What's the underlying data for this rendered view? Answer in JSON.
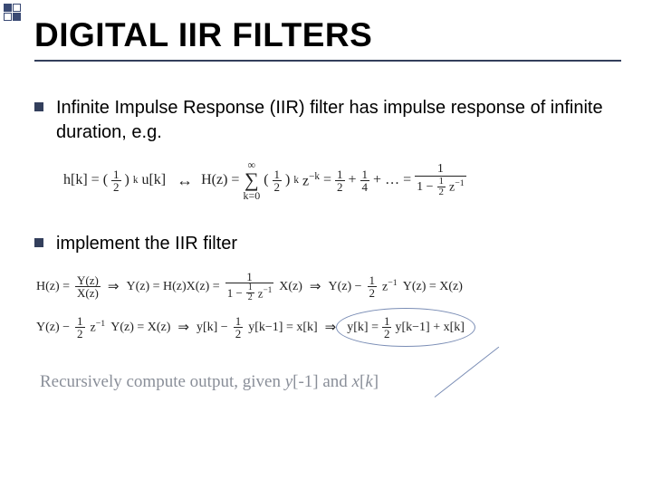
{
  "title": "DIGITAL IIR FILTERS",
  "bullets": [
    "Infinite Impulse Response (IIR) filter has impulse response of infinite duration, e.g.",
    "implement the IIR filter"
  ],
  "eq1": {
    "lhs_h": "h[k] =",
    "lhs_half_num": "1",
    "lhs_half_den": "2",
    "lhs_exp": "k",
    "lhs_u": "u[k]",
    "arrow": "↔",
    "Hz": "H(z) =",
    "sum_top": "∞",
    "sum_bot": "k=0",
    "sum_half_num": "1",
    "sum_half_den": "2",
    "sum_exp": "k",
    "z": "z",
    "z_exp": "−k",
    "eq_tail_start": "=",
    "tail_half1_num": "1",
    "tail_half1_den": "2",
    "tail_plus1": "+",
    "tail_half2_num": "1",
    "tail_half2_den": "4",
    "tail_plus2": "+ … =",
    "final_num": "1",
    "final_den_pre": "1 −",
    "final_den_half_num": "1",
    "final_den_half_den": "2",
    "final_den_z": "z",
    "final_den_zexp": "−1"
  },
  "eq2": {
    "line1": {
      "Hz": "H(z) =",
      "Yz": "Y(z)",
      "Xz": "X(z)",
      "impl": "⇒",
      "YzHX": "Y(z) = H(z)X(z) =",
      "one": "1",
      "den_pre": "1 −",
      "half_num": "1",
      "half_den": "2",
      "z": "z",
      "zexp": "−1",
      "Xz2": "X(z)",
      "impl2": "⇒",
      "Yz2": "Y(z) −",
      "half2_num": "1",
      "half2_den": "2",
      "z2": "z",
      "z2exp": "−1",
      "Yz3": "Y(z) = X(z)"
    },
    "line2": {
      "Yz": "Y(z) −",
      "half_num": "1",
      "half_den": "2",
      "z": "z",
      "zexp": "−1",
      "YzXz": "Y(z) = X(z)",
      "impl": "⇒",
      "yk": "y[k] −",
      "half2_num": "1",
      "half2_den": "2",
      "yk1": "y[k−1] = x[k]",
      "impl2": "⇒",
      "ykf": "y[k] =",
      "half3_num": "1",
      "half3_den": "2",
      "yk1x": "y[k−1] + x[k]"
    }
  },
  "footer": {
    "text_pre": "Recursively compute output, given ",
    "y": "y",
    "y_idx": "[-1]",
    "and": " and ",
    "x": "x",
    "x_idx": "[",
    "k": "k",
    "x_idx2": "]"
  }
}
